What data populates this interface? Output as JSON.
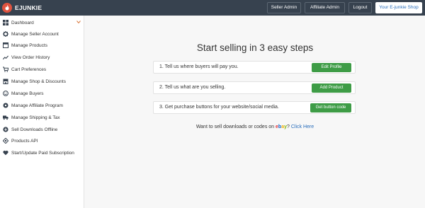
{
  "header": {
    "brand": "EJUNKIE",
    "buttons": [
      {
        "label": "Seller Admin"
      },
      {
        "label": "Affiliate Admin"
      },
      {
        "label": "Logout"
      },
      {
        "label": "Your E-junkie Shop"
      }
    ]
  },
  "sidebar": {
    "items": [
      {
        "label": "Dashboard",
        "icon": "dashboard-icon"
      },
      {
        "label": "Manage Seller Account",
        "icon": "gear-icon"
      },
      {
        "label": "Manage Products",
        "icon": "box-icon"
      },
      {
        "label": "View Order History",
        "icon": "trend-icon"
      },
      {
        "label": "Cart Preferences",
        "icon": "cart-icon"
      },
      {
        "label": "Manage Shop & Discounts",
        "icon": "shop-icon"
      },
      {
        "label": "Manage Buyers",
        "icon": "smiley-icon"
      },
      {
        "label": "Manage Affiliate Program",
        "icon": "network-icon"
      },
      {
        "label": "Manage Shipping & Tax",
        "icon": "truck-icon"
      },
      {
        "label": "Sell Downloads Offline",
        "icon": "download-icon"
      },
      {
        "label": "Products API",
        "icon": "api-icon"
      },
      {
        "label": "Start/Update Paid Subscription",
        "icon": "heart-icon"
      }
    ]
  },
  "main": {
    "heading": "Start selling in 3 easy steps",
    "steps": [
      {
        "text": "1. Tell us where buyers will pay you.",
        "button": "Edit Profile"
      },
      {
        "text": "2. Tell us what are you selling.",
        "button": "Add Product"
      },
      {
        "text": "3. Get purchase buttons for your website/social media.",
        "button": "Get button code"
      }
    ],
    "ebay": {
      "prefix": "Want to sell downloads or codes on",
      "logo": [
        "e",
        "b",
        "a",
        "y"
      ],
      "suffix": "?",
      "link": "Click Here"
    }
  },
  "colors": {
    "topbar": "#37424f",
    "accent_green": "#3e9c46",
    "link_blue": "#2a6ebb",
    "brand_red": "#e0533f"
  }
}
